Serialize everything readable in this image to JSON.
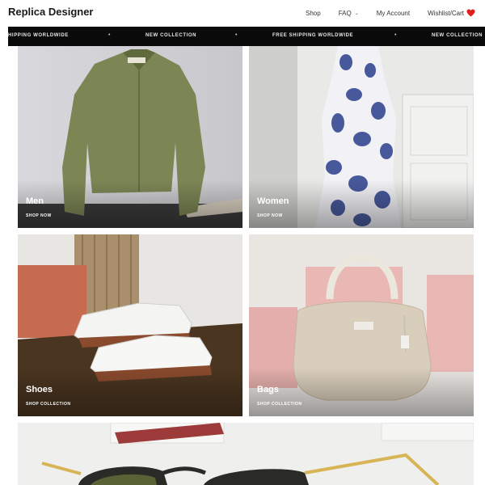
{
  "header": {
    "brand": "Replica Designer",
    "nav": {
      "shop": "Shop",
      "faq": "FAQ",
      "account": "My Account",
      "wishlist_cart": "Wishlist/Cart"
    }
  },
  "marquee": {
    "items": [
      "HIPPING WORLDWIDE",
      "NEW COLLECTION",
      "FREE SHIPPING WORLDWIDE",
      "NEW COLLECTION"
    ]
  },
  "categories": [
    {
      "title": "Men",
      "cta": "SHOP NOW"
    },
    {
      "title": "Women",
      "cta": "SHOP NOW"
    },
    {
      "title": "Shoes",
      "cta": "SHOP COLLECTION"
    },
    {
      "title": "Bags",
      "cta": "SHOP COLLECTION"
    }
  ],
  "colors": {
    "accent_heart": "#e0201e",
    "marquee_bg": "#0a0a0a"
  },
  "icons": {
    "faq_dropdown": "chevron-down-icon",
    "cart": "heart-icon"
  }
}
